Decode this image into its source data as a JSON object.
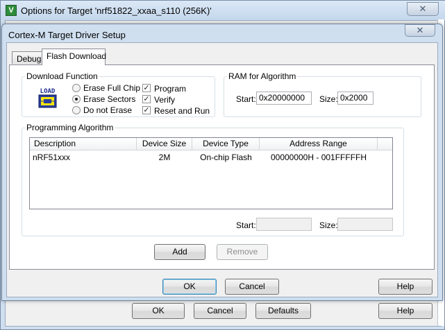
{
  "outer_window": {
    "title": "Options for Target 'nrf51822_xxaa_s110 (256K)'",
    "close_glyph": "✕",
    "buttons": {
      "ok": "OK",
      "cancel": "Cancel",
      "defaults": "Defaults",
      "help": "Help"
    }
  },
  "dialog": {
    "title": "Cortex-M Target Driver Setup",
    "close_glyph": "✕",
    "tabs": [
      {
        "label": "Debug",
        "active": false
      },
      {
        "label": "Flash Download",
        "active": true
      }
    ],
    "download_function": {
      "label": "Download Function",
      "icon_text": "LOAD",
      "radios": [
        {
          "label": "Erase Full Chip",
          "checked": false
        },
        {
          "label": "Erase Sectors",
          "checked": true
        },
        {
          "label": "Do not Erase",
          "checked": false
        }
      ],
      "checks": [
        {
          "label": "Program",
          "checked": true,
          "mark": "✓"
        },
        {
          "label": "Verify",
          "checked": true,
          "mark": "✓"
        },
        {
          "label": "Reset and Run",
          "checked": true,
          "mark": "✓"
        }
      ]
    },
    "ram_for_algorithm": {
      "label": "RAM for Algorithm",
      "start_label": "Start:",
      "start_value": "0x20000000",
      "size_label": "Size:",
      "size_value": "0x2000"
    },
    "programming_algorithm": {
      "label": "Programming Algorithm",
      "columns": [
        "Description",
        "Device Size",
        "Device Type",
        "Address Range"
      ],
      "rows": [
        {
          "description": "nRF51xxx",
          "device_size": "2M",
          "device_type": "On-chip Flash",
          "address_range": "00000000H - 001FFFFFH"
        }
      ],
      "start_label": "Start:",
      "start_value": "",
      "size_label": "Size:",
      "size_value": ""
    },
    "buttons": {
      "add": "Add",
      "remove": "Remove",
      "ok": "OK",
      "cancel": "Cancel",
      "help": "Help"
    }
  }
}
